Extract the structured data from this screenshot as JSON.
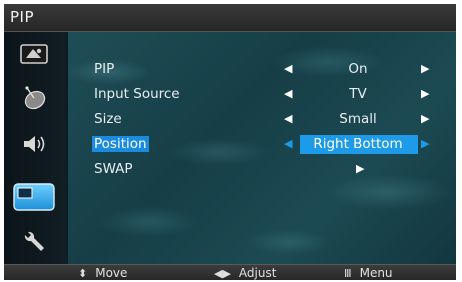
{
  "title": "PIP",
  "sidebar": {
    "items": [
      {
        "icon": "picture-icon"
      },
      {
        "icon": "satellite-dish-icon"
      },
      {
        "icon": "speaker-icon"
      },
      {
        "icon": "pip-icon",
        "active": true
      },
      {
        "icon": "wrench-icon"
      }
    ]
  },
  "menu": {
    "rows": [
      {
        "label": "PIP",
        "value": "On"
      },
      {
        "label": "Input Source",
        "value": "TV"
      },
      {
        "label": "Size",
        "value": "Small"
      },
      {
        "label": "Position",
        "value": "Right Bottom"
      },
      {
        "label": "SWAP",
        "value": ""
      }
    ]
  },
  "footer": {
    "move_label": "Move",
    "adjust_label": "Adjust",
    "menu_label": "Menu"
  },
  "colors": {
    "highlight": "#1e9be8",
    "panel": "#1f4d56"
  }
}
